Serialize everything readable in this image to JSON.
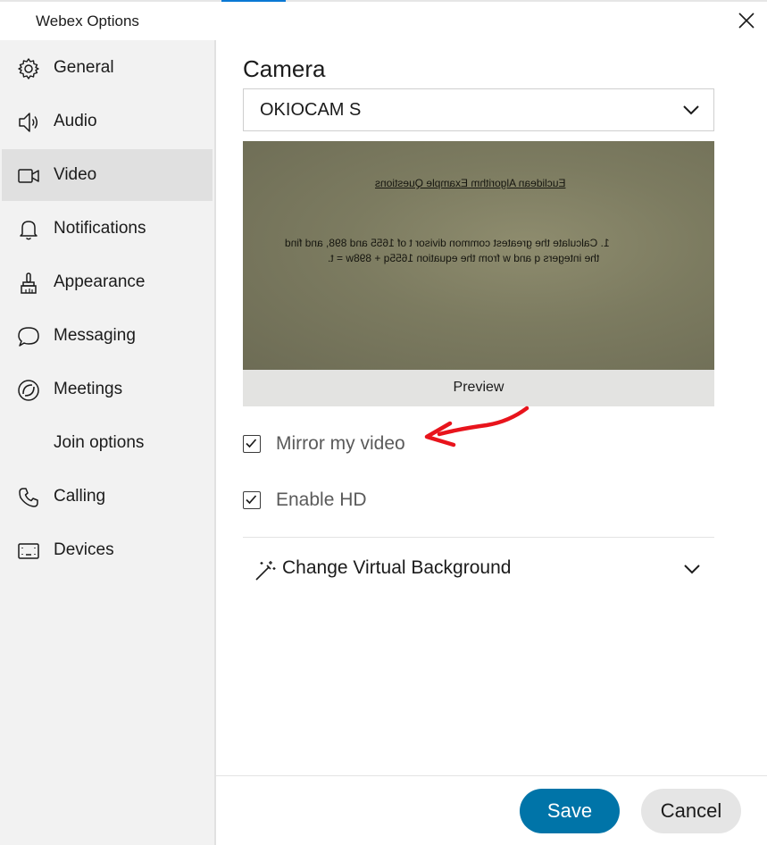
{
  "window": {
    "title": "Webex Options"
  },
  "sidebar": {
    "items": [
      {
        "label": "General",
        "icon": "gear-icon"
      },
      {
        "label": "Audio",
        "icon": "speaker-icon"
      },
      {
        "label": "Video",
        "icon": "video-camera-icon",
        "active": true
      },
      {
        "label": "Notifications",
        "icon": "bell-icon"
      },
      {
        "label": "Appearance",
        "icon": "paintbrush-icon"
      },
      {
        "label": "Messaging",
        "icon": "chat-bubble-icon"
      },
      {
        "label": "Meetings",
        "icon": "meetings-icon"
      },
      {
        "label": "Join options",
        "icon": ""
      },
      {
        "label": "Calling",
        "icon": "phone-icon"
      },
      {
        "label": "Devices",
        "icon": "device-icon"
      }
    ]
  },
  "camera": {
    "heading": "Camera",
    "selected_device": "OKIOCAM S",
    "preview_label": "Preview",
    "preview_content": {
      "title": "Euclidean Algorithm Example Questions",
      "line1": "1. Calculate the greatest common divisor t of 1655 and 898, and find",
      "line2": "the integers q and w from the equation 1655q + 898w = t."
    }
  },
  "options": {
    "mirror_label": "Mirror my video",
    "mirror_checked": true,
    "hd_label": "Enable HD",
    "hd_checked": true
  },
  "virtual_background": {
    "label": "Change Virtual Background"
  },
  "footer": {
    "save_label": "Save",
    "cancel_label": "Cancel"
  },
  "colors": {
    "accent": "#0074a8",
    "annotation": "#e8141c",
    "active_nav": "#e0e0e0"
  }
}
